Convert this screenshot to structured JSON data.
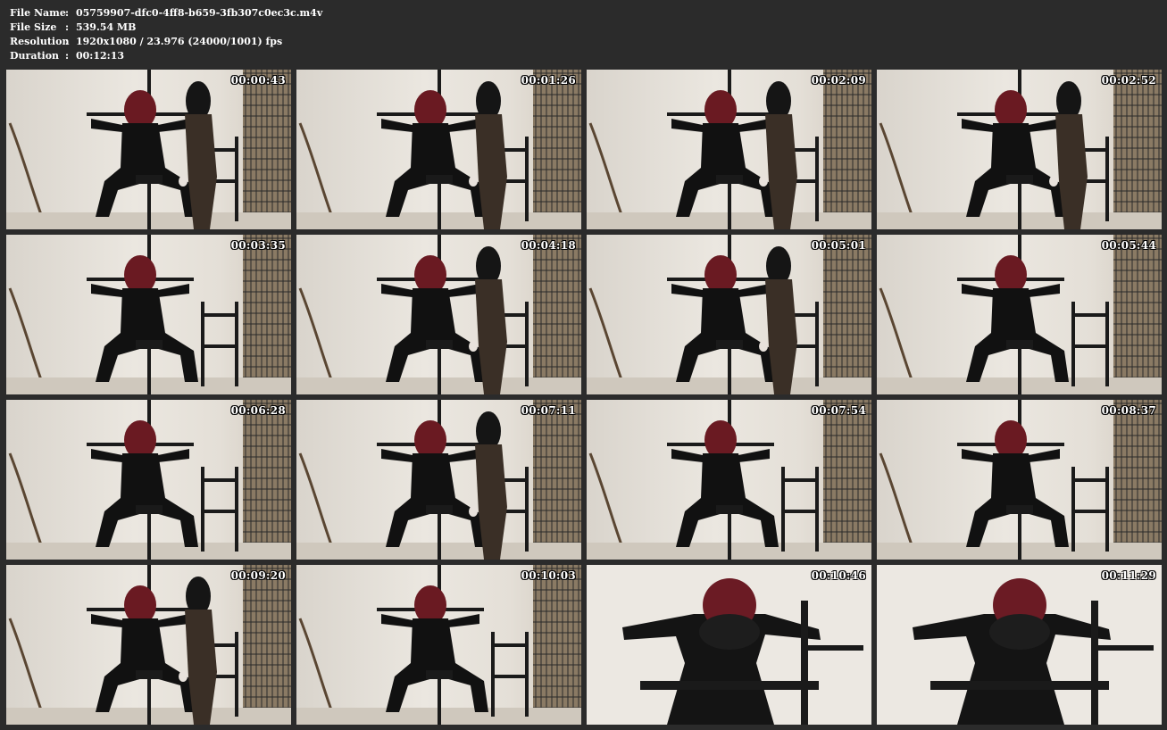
{
  "info": {
    "rows": [
      {
        "label": "File Name",
        "value": "05759907-dfc0-4ff8-b659-3fb307c0ec3c.m4v"
      },
      {
        "label": "File Size",
        "value": "539.54 MB"
      },
      {
        "label": "Resolution",
        "value": "1920x1080 / 23.976 (24000/1001) fps"
      },
      {
        "label": "Duration",
        "value": "00:12:13"
      }
    ],
    "separator": ":"
  },
  "thumbnails": [
    {
      "time": "00:00:43",
      "kind": "two"
    },
    {
      "time": "00:01:26",
      "kind": "two"
    },
    {
      "time": "00:02:09",
      "kind": "two"
    },
    {
      "time": "00:02:52",
      "kind": "two"
    },
    {
      "time": "00:03:35",
      "kind": "one"
    },
    {
      "time": "00:04:18",
      "kind": "two"
    },
    {
      "time": "00:05:01",
      "kind": "two"
    },
    {
      "time": "00:05:44",
      "kind": "one"
    },
    {
      "time": "00:06:28",
      "kind": "one"
    },
    {
      "time": "00:07:11",
      "kind": "two"
    },
    {
      "time": "00:07:54",
      "kind": "one"
    },
    {
      "time": "00:08:37",
      "kind": "one"
    },
    {
      "time": "00:09:20",
      "kind": "two"
    },
    {
      "time": "00:10:03",
      "kind": "one"
    },
    {
      "time": "00:10:46",
      "kind": "close"
    },
    {
      "time": "00:11:29",
      "kind": "close"
    }
  ]
}
